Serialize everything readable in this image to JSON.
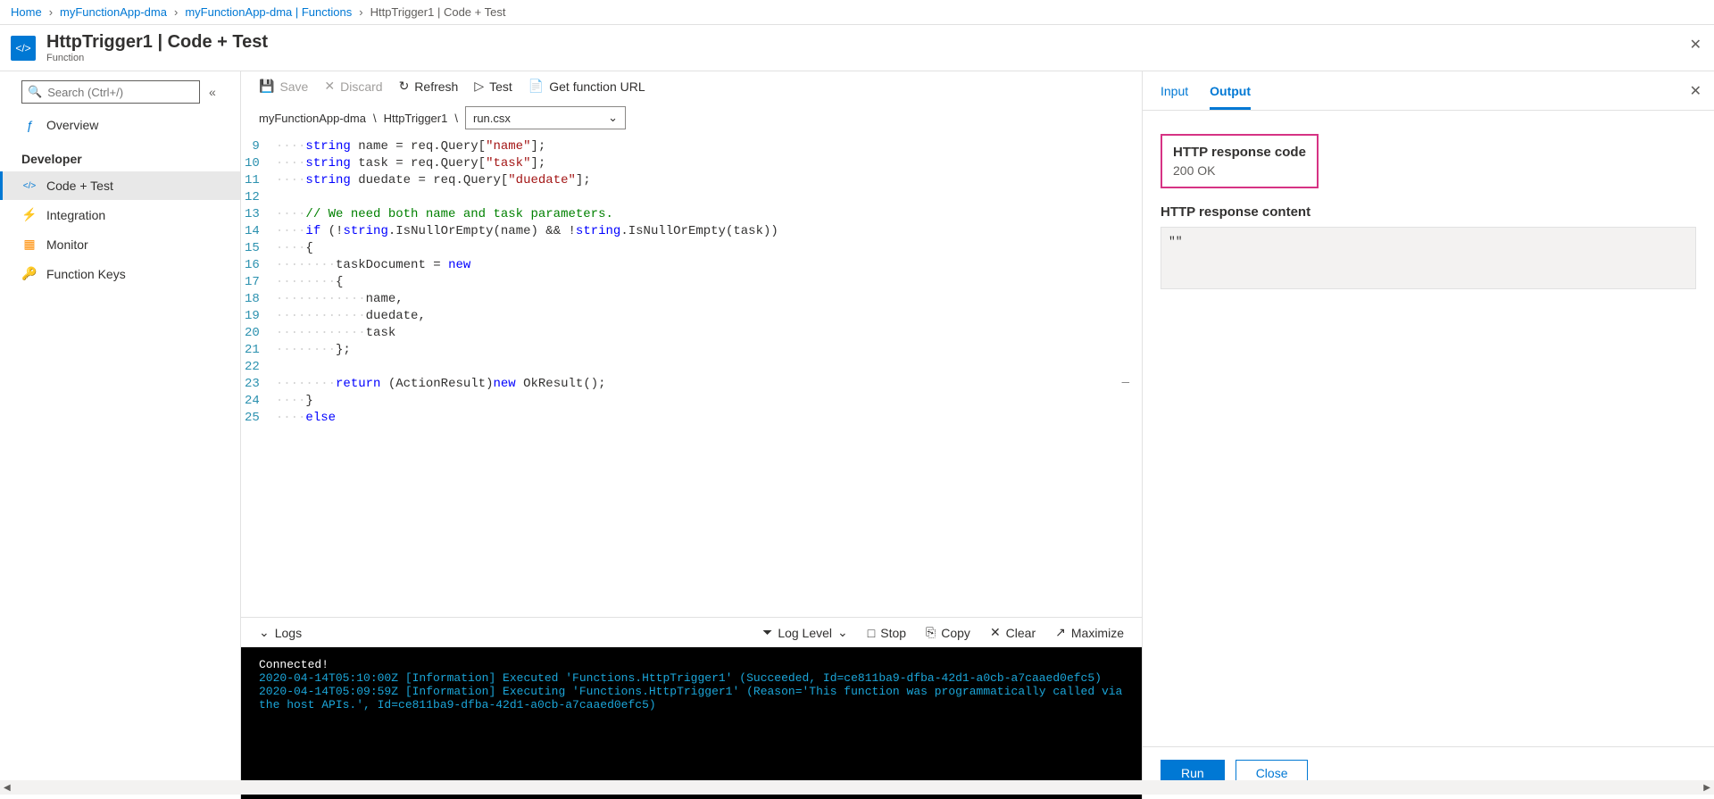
{
  "breadcrumb": {
    "home": "Home",
    "app": "myFunctionApp-dma",
    "functions": "myFunctionApp-dma | Functions",
    "current": "HttpTrigger1 | Code + Test"
  },
  "header": {
    "title": "HttpTrigger1 | Code + Test",
    "subtitle": "Function"
  },
  "search": {
    "placeholder": "Search (Ctrl+/)"
  },
  "nav": {
    "overview": "Overview",
    "developer_heading": "Developer",
    "code_test": "Code + Test",
    "integration": "Integration",
    "monitor": "Monitor",
    "function_keys": "Function Keys"
  },
  "toolbar": {
    "save": "Save",
    "discard": "Discard",
    "refresh": "Refresh",
    "test": "Test",
    "get_url": "Get function URL"
  },
  "path": {
    "app": "myFunctionApp-dma",
    "sep1": "\\",
    "func": "HttpTrigger1",
    "sep2": "\\",
    "file": "run.csx"
  },
  "code": {
    "lines": [
      9,
      10,
      11,
      12,
      13,
      14,
      15,
      16,
      17,
      18,
      19,
      20,
      21,
      22,
      23,
      24,
      25
    ]
  },
  "logs": {
    "label": "Logs",
    "log_level": "Log Level",
    "stop": "Stop",
    "copy": "Copy",
    "clear": "Clear",
    "maximize": "Maximize"
  },
  "console": {
    "connected": "Connected!",
    "l1": "2020-04-14T05:10:00Z   [Information]   Executed 'Functions.HttpTrigger1' (Succeeded, Id=ce811ba9-dfba-42d1-a0cb-a7caaed0efc5)",
    "l2": "2020-04-14T05:09:59Z   [Information]   Executing 'Functions.HttpTrigger1' (Reason='This function was programmatically called via the host APIs.', Id=ce811ba9-dfba-42d1-a0cb-a7caaed0efc5)"
  },
  "tabs": {
    "input": "Input",
    "output": "Output"
  },
  "output": {
    "code_label": "HTTP response code",
    "code_value": "200 OK",
    "content_label": "HTTP response content",
    "content_value": "\"\""
  },
  "buttons": {
    "run": "Run",
    "close": "Close"
  }
}
